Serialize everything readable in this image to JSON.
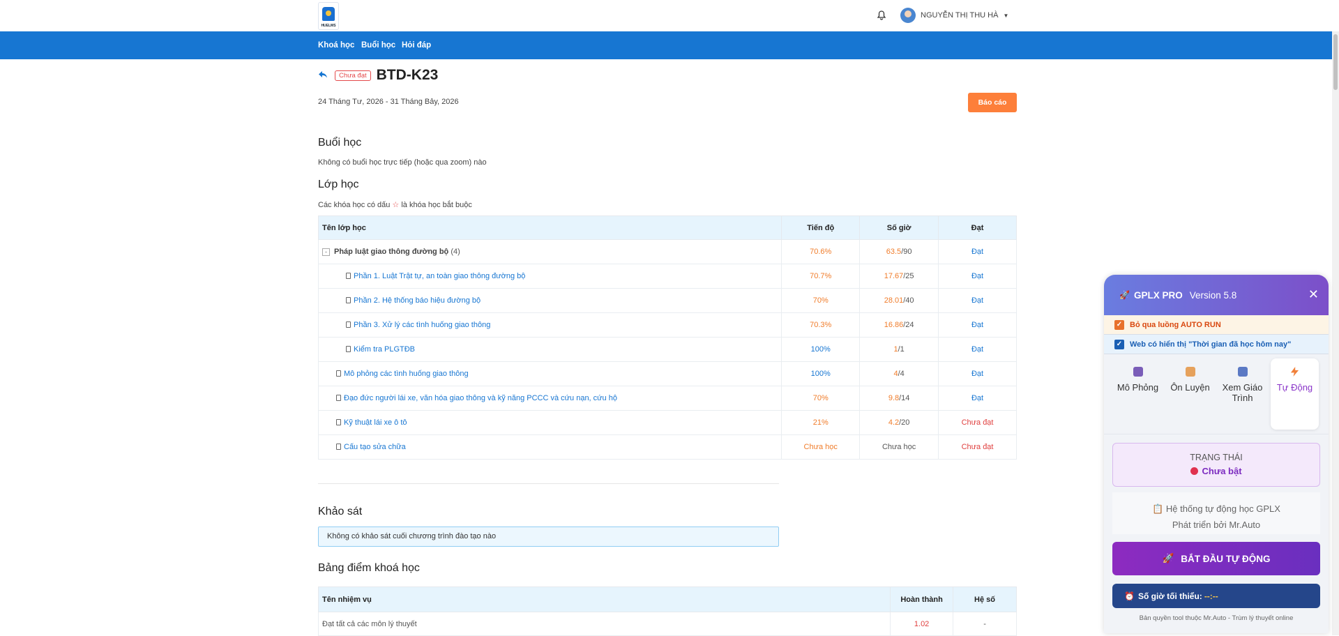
{
  "header": {
    "logo_text": "HUELMS",
    "user_name": "NGUYỄN THỊ THU HÀ"
  },
  "nav": [
    "Khoá học",
    "Buổi học",
    "Hỏi đáp"
  ],
  "course": {
    "status_badge": "Chưa đạt",
    "title": "BTD-K23",
    "dates": "24 Tháng Tư, 2026 - 31 Tháng Bảy, 2026",
    "report_label": "Báo cáo"
  },
  "sessions": {
    "heading": "Buổi học",
    "text": "Không có buổi học trực tiếp (hoặc qua zoom) nào"
  },
  "classes": {
    "heading": "Lớp học",
    "note_before": "Các khóa học có dấu",
    "note_after": "là khóa học bắt buộc",
    "columns": [
      "Tên lớp học",
      "Tiến độ",
      "Số giờ",
      "Đạt"
    ],
    "rows": [
      {
        "name": "Pháp luật giao thông đường bộ",
        "count": "(4)",
        "progress": "70.6%",
        "hours": "63.5",
        "total": "/90",
        "result": "Đạt"
      },
      {
        "name": "Phần 1. Luật Trật tự, an toàn giao thông đường bộ",
        "progress": "70.7%",
        "hours": "17.67",
        "total": "/25",
        "result": "Đạt"
      },
      {
        "name": "Phần 2. Hệ thống báo hiệu đường bộ",
        "progress": "70%",
        "hours": "28.01",
        "total": "/40",
        "result": "Đạt"
      },
      {
        "name": "Phần 3. Xử lý các tình huống giao thông",
        "progress": "70.3%",
        "hours": "16.86",
        "total": "/24",
        "result": "Đạt"
      },
      {
        "name": "Kiểm tra PLGTĐB",
        "progress": "100%",
        "hours": "1",
        "total": "/1",
        "result": "Đạt"
      },
      {
        "name": "Mô phỏng các tình huống giao thông",
        "progress": "100%",
        "hours": "4",
        "total": "/4",
        "result": "Đạt"
      },
      {
        "name": "Đạo đức người lái xe, văn hóa giao thông và kỹ năng PCCC và cứu nạn, cứu hộ",
        "progress": "70%",
        "hours": "9.8",
        "total": "/14",
        "result": "Đạt"
      },
      {
        "name": "Kỹ thuật lái xe ô tô",
        "progress": "21%",
        "hours": "4.2",
        "total": "/20",
        "result": "Chưa đạt"
      },
      {
        "name": "Cấu tạo sửa chữa",
        "progress": "Chưa học",
        "hours": "Chưa học",
        "total": "",
        "result": "Chưa đạt"
      }
    ]
  },
  "survey": {
    "heading": "Khảo sát",
    "text": "Không có khảo sát cuối chương trình đào tạo nào"
  },
  "scores": {
    "heading": "Bảng điểm khoá học",
    "columns": [
      "Tên nhiệm vụ",
      "Hoàn thành",
      "Hệ số"
    ],
    "rows": [
      {
        "name": "Đạt tất cả các môn lý thuyết",
        "done": "1.02",
        "coef": "-"
      }
    ]
  },
  "panel": {
    "title": "GPLX PRO",
    "version": "Version 5.8",
    "close": "✕",
    "option1": "Bỏ qua luồng AUTO RUN",
    "option2": "Web có hiển thị \"Thời gian đã học hôm nay\"",
    "tabs": [
      "Mô Phỏng",
      "Ôn Luyện",
      "Xem Giáo Trình",
      "Tự Động"
    ],
    "state_label": "TRẠNG THÁI",
    "state_value": "Chưa bật",
    "info_line1": "Hệ thống tự động học GPLX",
    "info_line2": "Phát triển bởi Mr.Auto",
    "start_label": "BẮT ĐẦU TỰ ĐỘNG",
    "min_label": "Số giờ tối thiểu:",
    "min_value": "--:--",
    "footer": "Bản quyền tool thuộc Mr.Auto - Trùm lý thuyết online"
  },
  "colors": {
    "primary": "#1776d2",
    "accent": "#fd7f3a",
    "fail": "#e0403f",
    "panel_purple": "#7c4fc9"
  }
}
